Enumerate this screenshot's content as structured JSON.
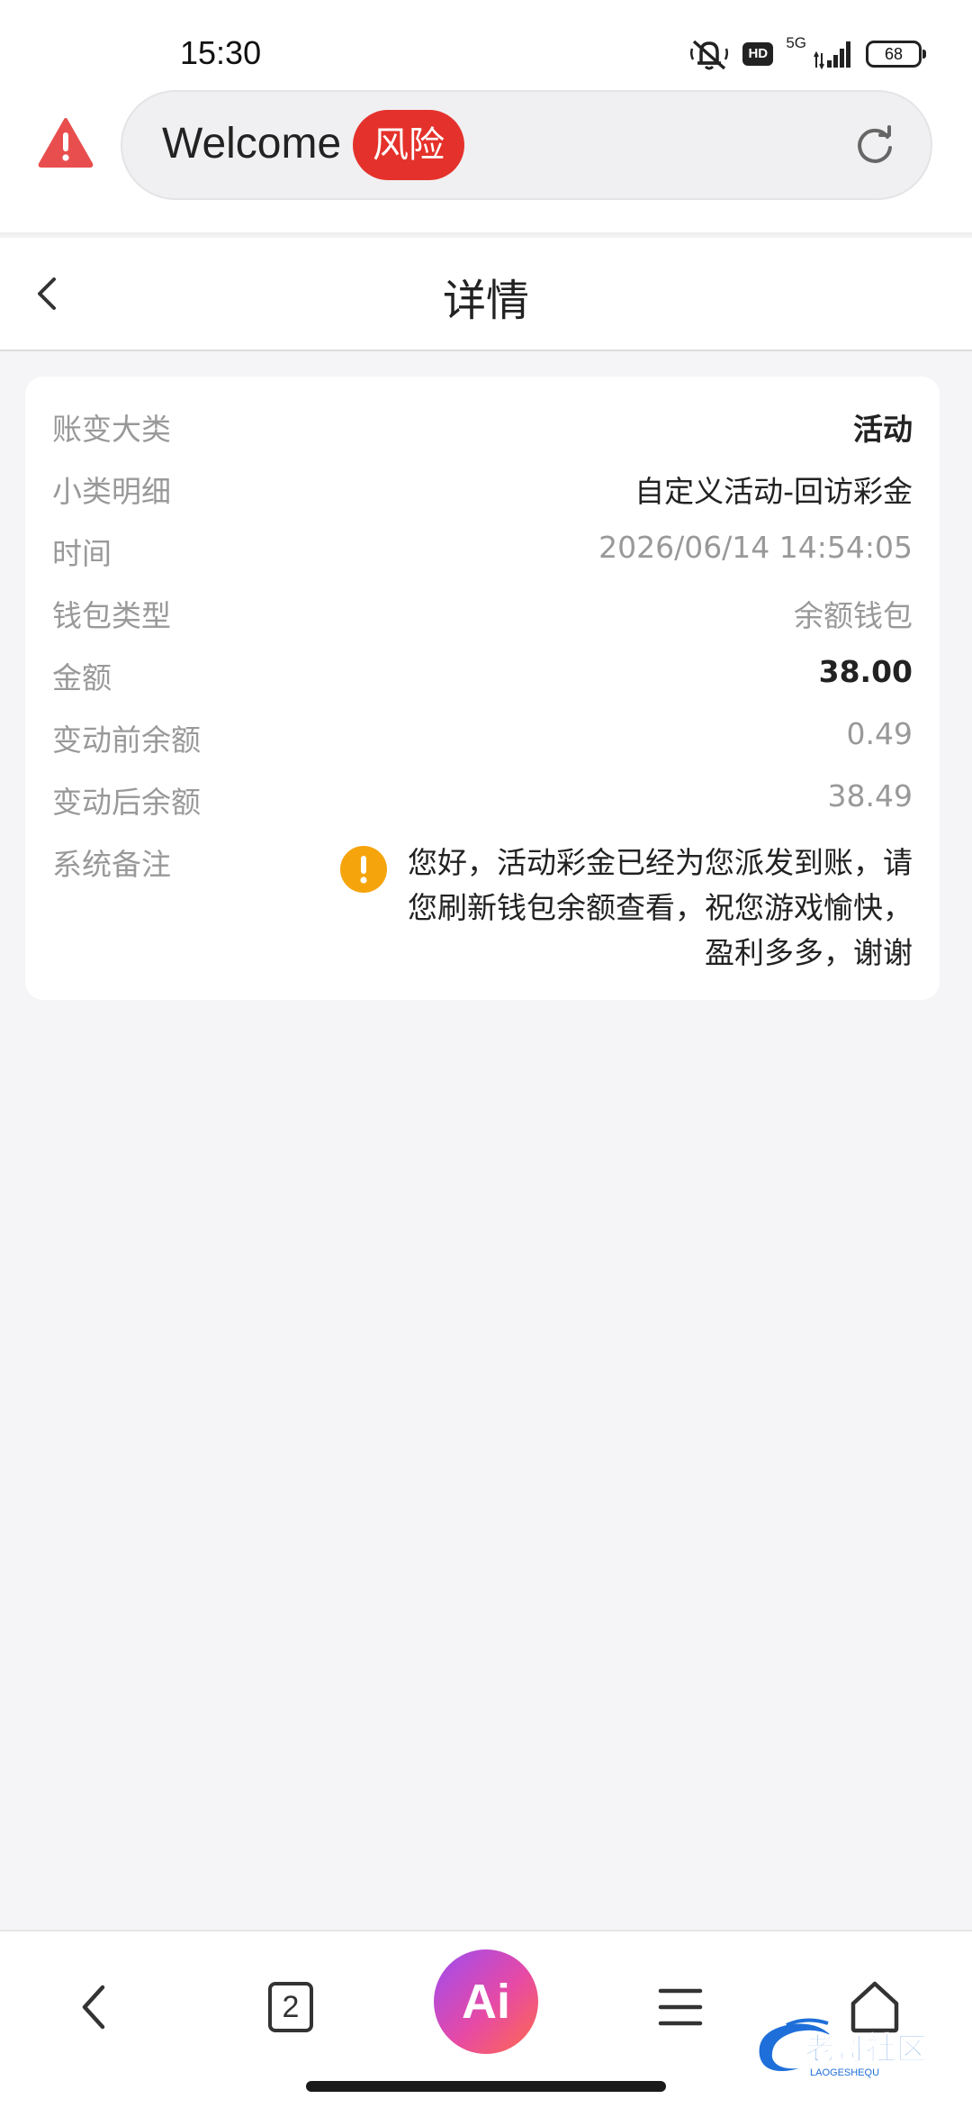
{
  "status_bar": {
    "time": "15:30",
    "network": "5G",
    "hd": "HD",
    "battery": "68"
  },
  "browser": {
    "url_text": "Welcome",
    "risk_badge": "风险"
  },
  "header": {
    "title": "详情"
  },
  "details": [
    {
      "label": "账变大类",
      "value": "活动"
    },
    {
      "label": "小类明细",
      "value": "自定义活动-回访彩金"
    },
    {
      "label": "时间",
      "value": "2026/06/14 14:54:05"
    },
    {
      "label": "钱包类型",
      "value": "余额钱包"
    },
    {
      "label": "金额",
      "value": "38.00"
    },
    {
      "label": "变动前余额",
      "value": "0.49"
    },
    {
      "label": "变动后余额",
      "value": "38.49"
    }
  ],
  "note": {
    "label": "系统备注",
    "text": "您好，活动彩金已经为您派发到账，请您刷新钱包余额查看，祝您游戏愉快，盈利多多，谢谢"
  },
  "bottom_nav": {
    "tab_count": "2",
    "ai_label": "Ai"
  },
  "watermark": {
    "text": "老哥社区",
    "subtext": "LAOGESHEQU"
  },
  "colors": {
    "accent_red": "#e5312b",
    "warning_orange": "#f5a40c",
    "muted_text": "#999999"
  }
}
